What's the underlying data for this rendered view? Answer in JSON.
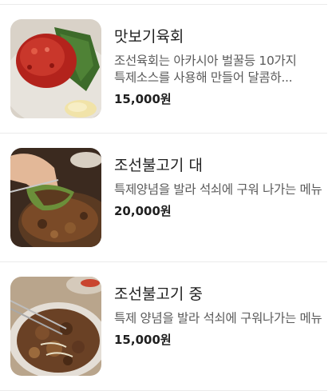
{
  "menu": {
    "items": [
      {
        "name": "맛보기육회",
        "description": "조선육회는 아카시아 벌꿀등 10가지 특제소스를 사용해 만들어 달콤하...",
        "price": "15,000원"
      },
      {
        "name": "조선불고기 대",
        "description": "특제양념을 발라 석쇠에 구워 나가는 메뉴",
        "price": "20,000원"
      },
      {
        "name": "조선불고기 중",
        "description": "특제 양념을 발라 석쇠에 구워나가는 메뉴",
        "price": "15,000원"
      }
    ]
  }
}
